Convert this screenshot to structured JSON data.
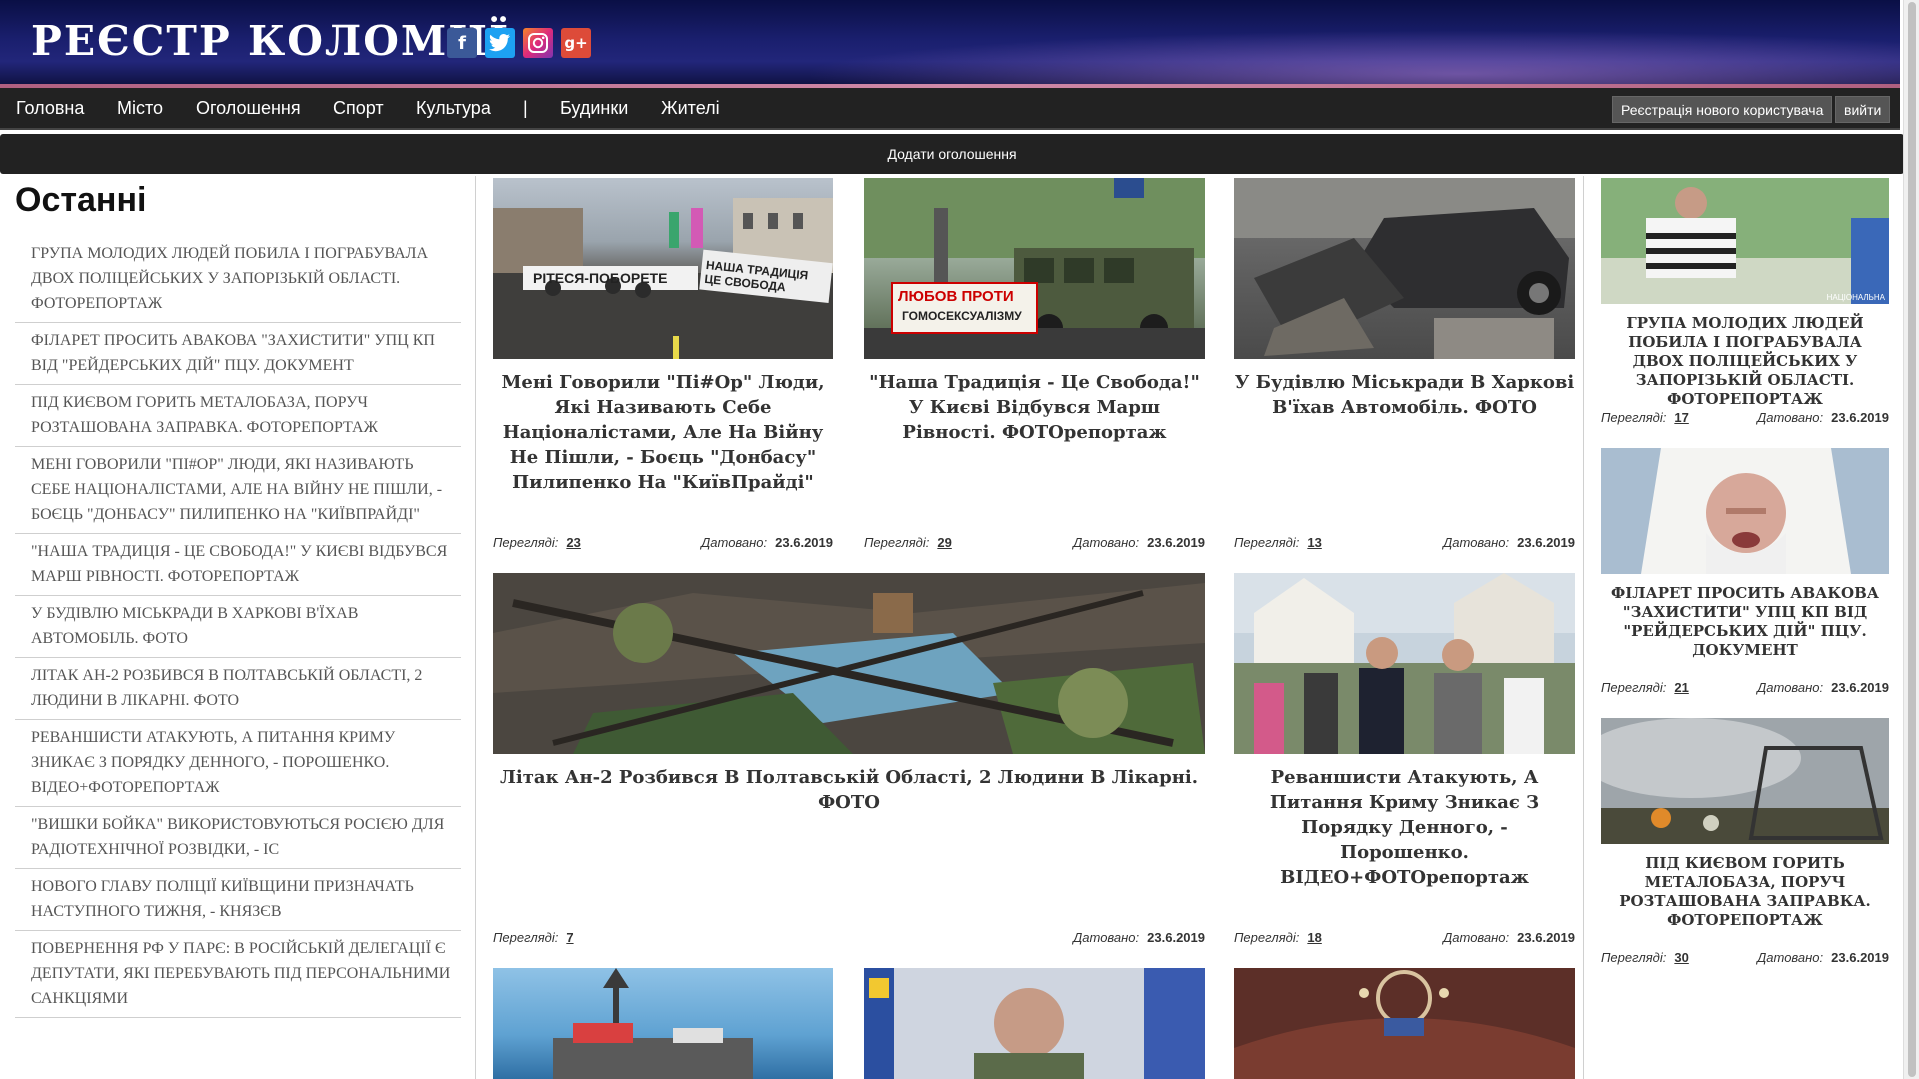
{
  "site": {
    "title": "РЕЄСТР КОЛОМИЇ"
  },
  "social": [
    {
      "icon": "facebook-icon",
      "glyph": "f"
    },
    {
      "icon": "twitter-icon",
      "glyph": "t"
    },
    {
      "icon": "instagram-icon",
      "glyph": "◎"
    },
    {
      "icon": "google-plus-icon",
      "glyph": "g+"
    }
  ],
  "nav": {
    "items": [
      "Головна",
      "Місто",
      "Оголошення",
      "Спорт",
      "Культура",
      "|",
      "Будинки",
      "Жителі"
    ],
    "register": "Реєстрація нового користувача",
    "logout": "вийти",
    "add_ad": "Додати оголошення"
  },
  "latest": {
    "heading": "Останні",
    "items": [
      "Група молодих людей побила і пограбувала двох поліцейських у Запорізькій області. ФОТОрепортаж",
      "Філарет просить Авакова \"захистити\" УПЦ КП від \"рейдерських дій\" ПЦУ. ДОКУМЕНТ",
      "Під Києвом горить металобаза, поруч розташована заправка. ФОТОрепортаж",
      "Мені говорили \"пі#ор\" люди, які називають себе націоналістами, але на війну не пішли, - боєць \"Донбасу\" Пилипенко на \"КиївПрайді\"",
      "\"Наша традиція - це свобода!\" У Києві відбувся Марш рівності. ФОТОрепортаж",
      "У будівлю міськради в Харкові в'їхав автомобіль. ФОТО",
      "Літак Ан-2 розбився в Полтавській області, 2 людини в лікарні. ФОТО",
      "Реваншисти атакують, а питання Криму зникає з порядку денного, - Порошенко. ВІДЕО+ФОТОрепортаж",
      "\"Вишки Бойка\" використовуються Росією для радіотехнічної розвідки, - ІС",
      "Нового главу поліції Київщини призначать наступного тижня, - Князєв",
      "Повернення РФ у ПАРЄ: в російській делегації є депутати, які перебувають під персональними санкціями"
    ]
  },
  "labels": {
    "views": "Переглядi:",
    "dated": "Датовано:"
  },
  "articles": [
    {
      "title": "Мені Говорили \"Пі#Ор\" Люди, Які Називають Себе Націоналістами, Але На Війну Не Пішли, - Боєць \"Донбасу\" Пилипенко На \"КиївПрайді\"",
      "views": "23",
      "date": "23.6.2019",
      "sign1": "РІТЕСЯ-ПОБОРЕТЕ",
      "sign2": "НАША ТРАДИЦІЯ ЦЕ СВОБОДА"
    },
    {
      "title": "\"Наша Традиція - Це Свобода!\" У Києві Відбувся Марш Рівності. ФОТОрепортаж",
      "views": "29",
      "date": "23.6.2019",
      "sign1": "ЛЮБОВ ПРОТИ",
      "sign2": "ГОМОСЕКСУАЛІЗМУ"
    },
    {
      "title": "У Будівлю Міськради В Харкові В'їхав Автомобіль. ФОТО",
      "views": "13",
      "date": "23.6.2019"
    },
    {
      "title": "Літак Ан-2 Розбився В Полтавській Області, 2 Людини В Лікарні. ФОТО",
      "views": "7",
      "date": "23.6.2019"
    },
    {
      "title": "Реваншисти Атакують, А Питання Криму Зникає З Порядку Денного, - Порошенко. ВІДЕО+ФОТОрепортаж",
      "views": "18",
      "date": "23.6.2019"
    }
  ],
  "sidebar": [
    {
      "title": "Група молодих людей побила і пограбувала двох поліцейських у Запорізькій області. ФОТОрепортаж",
      "views": "17",
      "date": "23.6.2019",
      "watermark": "НАЦІОНАЛЬНА"
    },
    {
      "title": "Філарет просить Авакова \"захистити\" УПЦ КП від \"рейдерських дій\" ПЦУ. ДОКУМЕНТ",
      "views": "21",
      "date": "23.6.2019"
    },
    {
      "title": "Під Києвом горить металобаза, поруч розташована заправка. ФОТОрепортаж",
      "views": "30",
      "date": "23.6.2019"
    }
  ],
  "colors": {
    "header_bg": "#0d1250",
    "nav_bg": "#222222",
    "title_text": "#333333"
  }
}
